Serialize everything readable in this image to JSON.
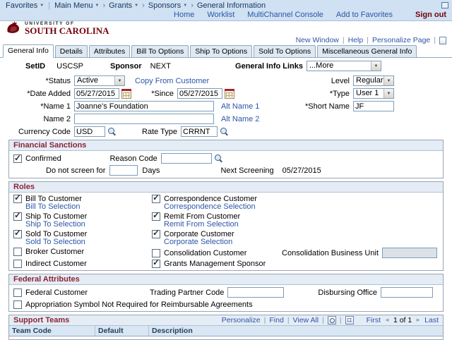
{
  "colors": {
    "garnet": "#73000a",
    "link": "#2b56a7",
    "band": "#cfe1f2",
    "section_title": "#8a2432",
    "section_band": "#e4ecf6",
    "grid_head": "#d9e6f3"
  },
  "topnav": {
    "favorites": "Favorites",
    "main_menu": "Main Menu",
    "crumb_grants": "Grants",
    "crumb_sponsors": "Sponsors",
    "current": "General Information"
  },
  "userbar": {
    "home": "Home",
    "worklist": "Worklist",
    "console": "MultiChannel Console",
    "add_favorites": "Add to Favorites",
    "sign_out": "Sign out"
  },
  "logo": {
    "line1": "UNIVERSITY OF",
    "line2": "SOUTH CAROLINA"
  },
  "pagebar": {
    "new_window": "New Window",
    "help": "Help",
    "personalize": "Personalize Page"
  },
  "tabs": [
    "General Info",
    "Details",
    "Attributes",
    "Bill To Options",
    "Ship To Options",
    "Sold To Options",
    "Miscellaneous General Info"
  ],
  "form": {
    "setid_label": "SetID",
    "setid_value": "USCSP",
    "sponsor_label": "Sponsor",
    "sponsor_value": "NEXT",
    "info_links_label": "General Info Links",
    "info_links_value": "...More",
    "status_label": "*Status",
    "status_value": "Active",
    "copy_link": "Copy From Customer",
    "level_label": "Level",
    "level_value": "Regular",
    "date_added_label": "*Date Added",
    "date_added_value": "05/27/2015",
    "since_label": "*Since",
    "since_value": "05/27/2015",
    "type_label": "*Type",
    "type_value": "User 1",
    "name1_label": "*Name 1",
    "name1_value": "Joanne's Foundation",
    "alt_name1_link": "Alt Name 1",
    "short_name_label": "*Short Name",
    "short_name_value": "JF",
    "name2_label": "Name 2",
    "name2_value": "",
    "alt_name2_link": "Alt Name 2",
    "currency_label": "Currency Code",
    "currency_value": "USD",
    "rate_type_label": "Rate Type",
    "rate_type_value": "CRRNT"
  },
  "sanctions": {
    "title": "Financial Sanctions",
    "confirmed_label": "Confirmed",
    "confirmed_checked": true,
    "reason_label": "Reason Code",
    "reason_value": "",
    "screen_label": "Do not screen for",
    "screen_value": "",
    "days_label": "Days",
    "next_label": "Next Screening",
    "next_value": "05/27/2015"
  },
  "roles": {
    "title": "Roles",
    "items": [
      {
        "label": "Bill To Customer",
        "checked": true,
        "link": "Bill To Selection"
      },
      {
        "label": "Correspondence Customer",
        "checked": true,
        "link": "Correspondence Selection"
      },
      {
        "label": "Ship To Customer",
        "checked": true,
        "link": "Ship To Selection"
      },
      {
        "label": "Remit From Customer",
        "checked": true,
        "link": "Remit From Selection"
      },
      {
        "label": "Sold To Customer",
        "checked": true,
        "link": "Sold To Selection"
      },
      {
        "label": "Corporate Customer",
        "checked": true,
        "link": "Corporate Selection"
      },
      {
        "label": "Broker Customer",
        "checked": false
      },
      {
        "label": "Consolidation Customer",
        "checked": false
      },
      {
        "label": "Indirect Customer",
        "checked": false
      },
      {
        "label": "Grants Management Sponsor",
        "checked": true
      }
    ],
    "consolidation_bu_label": "Consolidation Business Unit",
    "consolidation_bu_value": ""
  },
  "federal": {
    "title": "Federal Attributes",
    "federal_label": "Federal Customer",
    "federal_checked": false,
    "trading_label": "Trading Partner Code",
    "trading_value": "",
    "disbursing_label": "Disbursing Office",
    "disbursing_value": "",
    "appropriation_label": "Appropriation Symbol Not Required for Reimbursable Agreements",
    "appropriation_checked": false
  },
  "support": {
    "title": "Support Teams",
    "personalize": "Personalize",
    "find": "Find",
    "view_all": "View All",
    "first": "First",
    "pager": "1 of 1",
    "last": "Last",
    "columns": [
      "Team Code",
      "Default",
      "Description"
    ]
  }
}
